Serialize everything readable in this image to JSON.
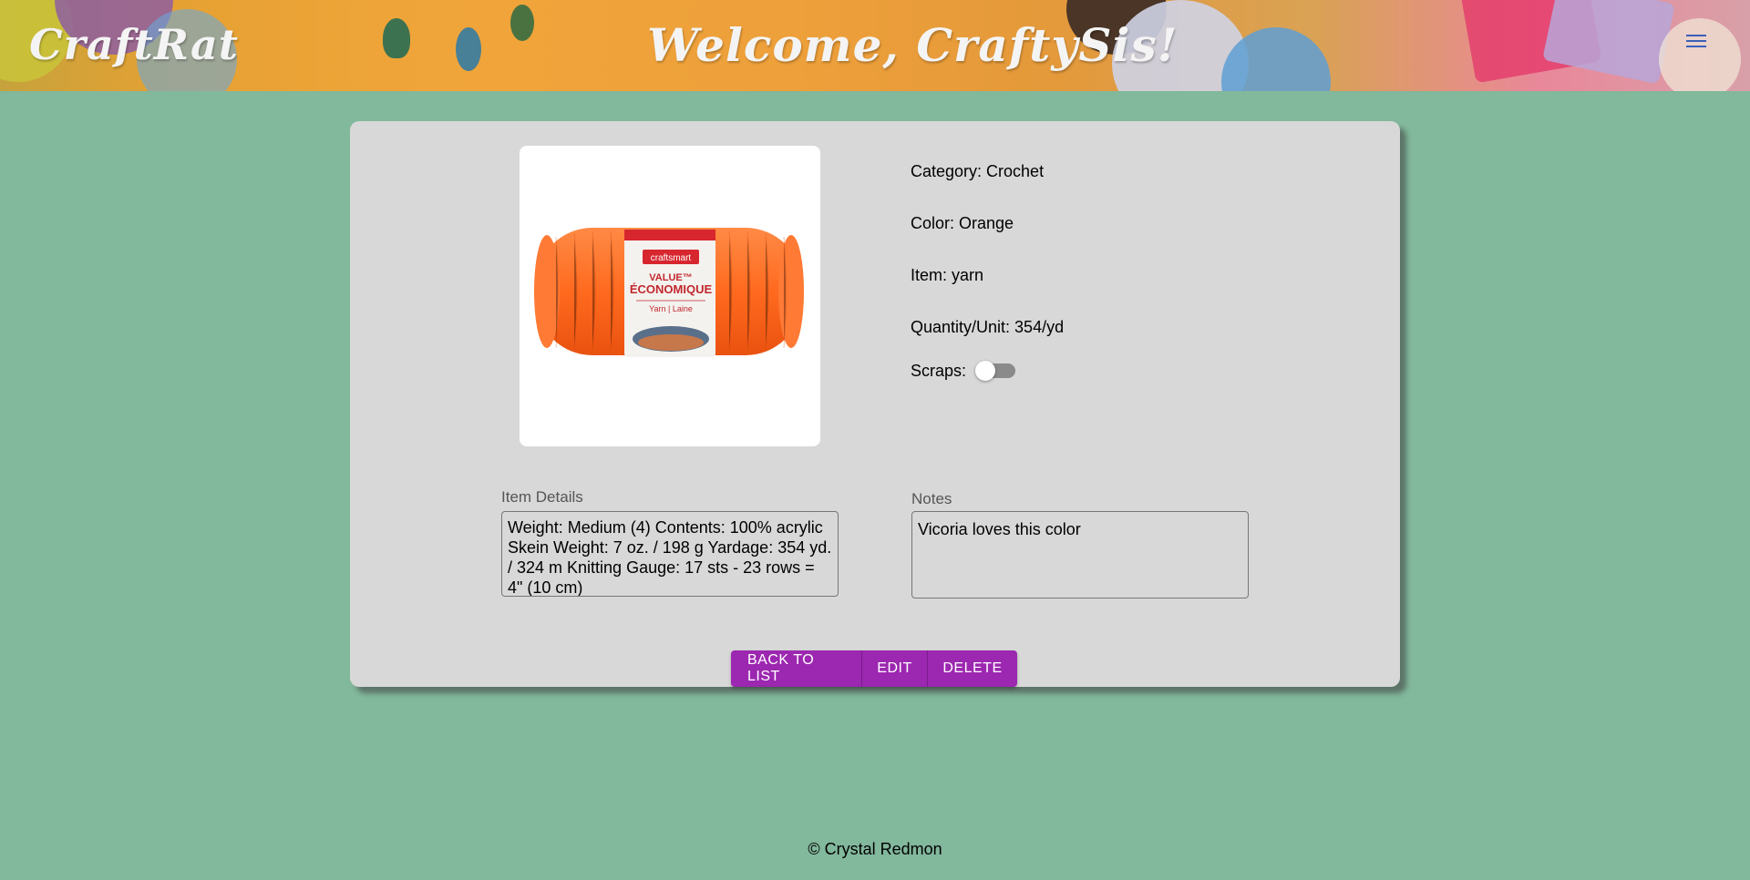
{
  "header": {
    "brand": "CraftRat",
    "welcome": "Welcome, CraftySis!",
    "menu_icon": "hamburger-menu-icon",
    "menu_color": "#3a5fb8"
  },
  "item": {
    "image": {
      "label_brand": "craftsmart",
      "label_line1": "VALUE™",
      "label_line2": "ÉCONOMIQUE",
      "label_line3": "Yarn | Laine",
      "yarn_color": "#ff6a1f"
    },
    "category": "Category: Crochet",
    "color": "Color: Orange",
    "name": "Item: yarn",
    "quantity": "Quantity/Unit: 354/yd",
    "scraps_label": "Scraps:",
    "scraps_on": false
  },
  "details": {
    "label": "Item Details",
    "value": "Weight: Medium (4) Contents: 100% acrylic Skein Weight: 7 oz. / 198 g Yardage: 354 yd. / 324 m Knitting Gauge: 17 sts - 23 rows = 4\" (10 cm)"
  },
  "notes": {
    "label": "Notes",
    "value": "Vicoria loves this color"
  },
  "actions": {
    "back": "BACK TO LIST",
    "edit": "EDIT",
    "delete": "DELETE",
    "accent": "#9c27b0"
  },
  "footer": {
    "text": "© Crystal Redmon"
  }
}
